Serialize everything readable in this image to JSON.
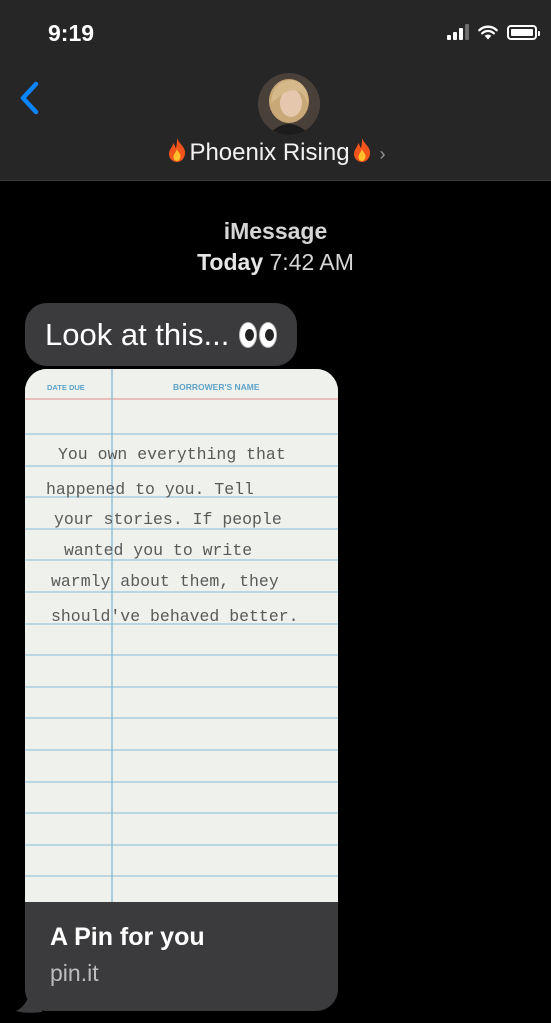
{
  "status_bar": {
    "time": "9:19",
    "icons": [
      "cellular-signal-icon",
      "wifi-icon",
      "battery-icon"
    ]
  },
  "header": {
    "contact_name": "Phoenix Rising",
    "name_emoji": "fire",
    "back_icon": "chevron-left-icon",
    "disclosure_icon": "chevron-right-icon",
    "accent_color": "#0a84ff"
  },
  "thread": {
    "service": "iMessage",
    "day": "Today",
    "time": "7:42 AM"
  },
  "messages": [
    {
      "type": "text",
      "text": "Look at this...",
      "emoji": "eyes"
    },
    {
      "type": "link_preview",
      "card_text": {
        "col1": "DATE DUE",
        "col2": "BORROWER'S NAME",
        "lines": [
          "You own everything that",
          "happened to you. Tell",
          "your stories. If people",
          "wanted you to write",
          "warmly about them, they",
          "should've behaved better."
        ]
      },
      "title": "A Pin for you",
      "domain": "pin.it"
    }
  ]
}
